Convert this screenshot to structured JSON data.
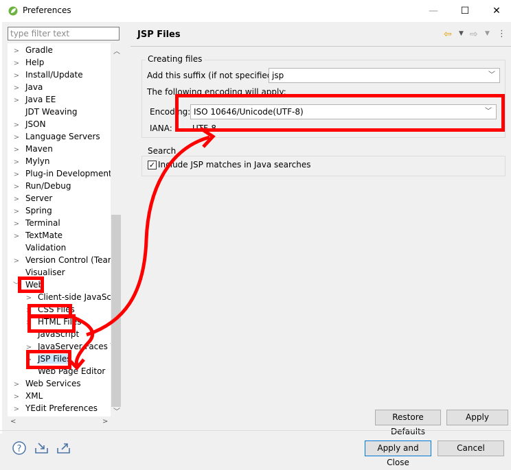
{
  "window": {
    "title": "Preferences",
    "minimize": "—",
    "maximize": "☐",
    "close": "✕"
  },
  "filter": {
    "placeholder": "type filter text"
  },
  "tree": {
    "items": [
      {
        "label": "Gradle",
        "twisty": true
      },
      {
        "label": "Help",
        "twisty": true
      },
      {
        "label": "Install/Update",
        "twisty": true
      },
      {
        "label": "Java",
        "twisty": true
      },
      {
        "label": "Java EE",
        "twisty": true
      },
      {
        "label": "JDT Weaving",
        "twisty": false
      },
      {
        "label": "JSON",
        "twisty": true
      },
      {
        "label": "Language Servers",
        "twisty": true
      },
      {
        "label": "Maven",
        "twisty": true
      },
      {
        "label": "Mylyn",
        "twisty": true
      },
      {
        "label": "Plug-in Development",
        "twisty": true
      },
      {
        "label": "Run/Debug",
        "twisty": true
      },
      {
        "label": "Server",
        "twisty": true
      },
      {
        "label": "Spring",
        "twisty": true
      },
      {
        "label": "Terminal",
        "twisty": true
      },
      {
        "label": "TextMate",
        "twisty": true
      },
      {
        "label": "Validation",
        "twisty": false
      },
      {
        "label": "Version Control (Team)",
        "twisty": true
      },
      {
        "label": "Visualiser",
        "twisty": false
      },
      {
        "label": "Web",
        "twisty": "open"
      },
      {
        "label": "Client-side JavaScript",
        "twisty": true,
        "child": true
      },
      {
        "label": "CSS Files",
        "twisty": true,
        "child": true
      },
      {
        "label": "HTML Files",
        "twisty": true,
        "child": true
      },
      {
        "label": "JavaScript",
        "twisty": false,
        "child": true
      },
      {
        "label": "JavaServer Faces Tools",
        "twisty": true,
        "child": true
      },
      {
        "label": "JSP Files",
        "twisty": true,
        "child": true,
        "selected": true
      },
      {
        "label": "Web Page Editor",
        "twisty": false,
        "child": true
      },
      {
        "label": "Web Services",
        "twisty": true
      },
      {
        "label": "XML",
        "twisty": true
      },
      {
        "label": "YEdit Preferences",
        "twisty": true
      }
    ]
  },
  "page": {
    "title": "JSP Files",
    "creating_files": {
      "group_title": "Creating files",
      "suffix_label": "Add this suffix (if not specified):",
      "suffix_value": "jsp",
      "encoding_note": "The following encoding will apply:",
      "encoding_label": "Encoding:",
      "encoding_value": "ISO 10646/Unicode(UTF-8)",
      "iana_label": "IANA:",
      "iana_value": "UTF-8"
    },
    "search": {
      "group_title": "Search",
      "checkbox_label": "Include JSP matches in Java searches",
      "checked": true
    },
    "restore_defaults": "Restore Defaults",
    "apply": "Apply"
  },
  "footer": {
    "apply_and_close": "Apply and Close",
    "cancel": "Cancel"
  },
  "colors": {
    "annotation": "#ff0000",
    "selection": "#cce8ff"
  }
}
